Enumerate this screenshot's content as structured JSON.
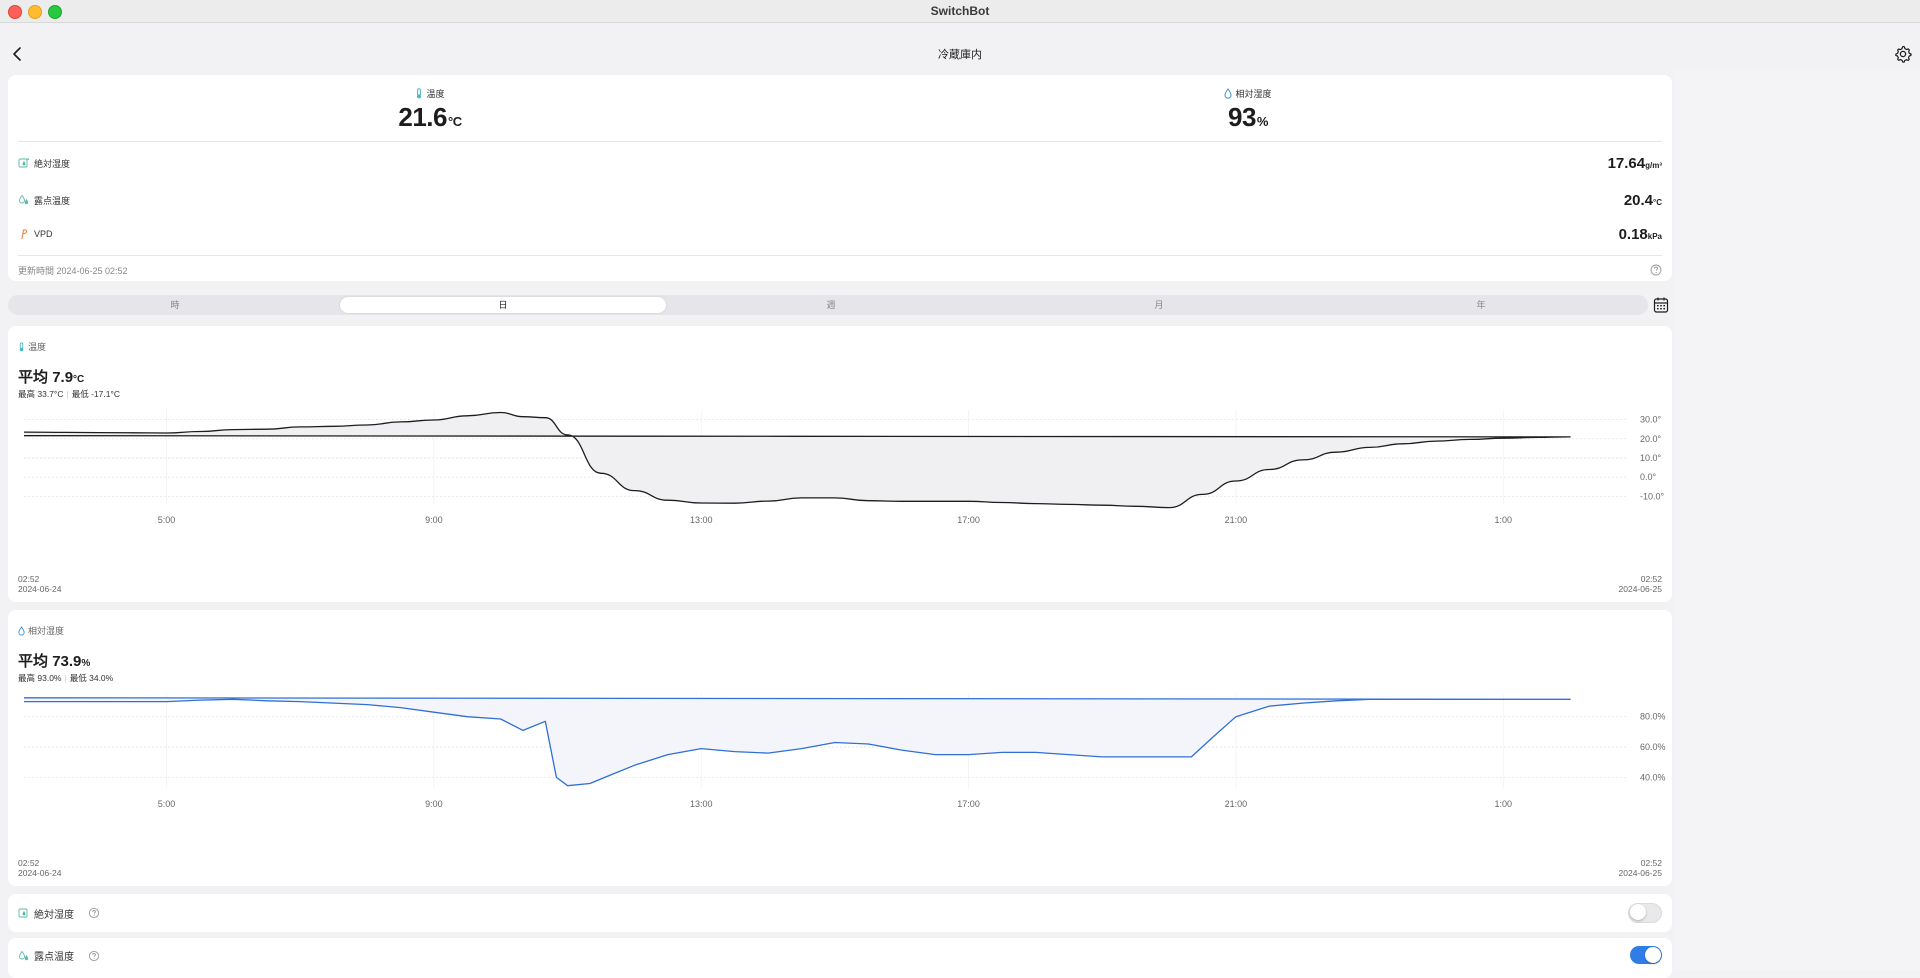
{
  "app": {
    "title": "SwitchBot"
  },
  "nav": {
    "title": "冷蔵庫内"
  },
  "summary": {
    "temperature": {
      "label": "温度",
      "value": "21.6",
      "unit": "°C"
    },
    "humidity": {
      "label": "相対湿度",
      "value": "93",
      "unit": "%"
    },
    "rows": [
      {
        "label": "絶対湿度",
        "value": "17.64",
        "unit": "g/m³",
        "icon": "absolute-humidity-icon"
      },
      {
        "label": "露点温度",
        "value": "20.4",
        "unit": "°C",
        "icon": "dew-point-icon"
      },
      {
        "label": "VPD",
        "value": "0.18",
        "unit": "kPa",
        "icon": "vpd-icon"
      }
    ],
    "updated": "更新時間 2024-06-25 02:52"
  },
  "range_tabs": {
    "items": [
      "時",
      "日",
      "週",
      "月",
      "年"
    ],
    "selected": "日"
  },
  "temp_chart": {
    "label": "温度",
    "avg_prefix": "平均",
    "avg_value": "7.9",
    "avg_unit": "°C",
    "max_label": "最高",
    "max_value": "33.7°C",
    "min_label": "最低",
    "min_value": "-17.1°C",
    "start_time": "02:52",
    "start_date": "2024-06-24",
    "end_time": "02:52",
    "end_date": "2024-06-25"
  },
  "hum_chart": {
    "label": "相対湿度",
    "avg_prefix": "平均",
    "avg_value": "73.9",
    "avg_unit": "%",
    "max_label": "最高",
    "max_value": "93.0%",
    "min_label": "最低",
    "min_value": "34.0%",
    "start_time": "02:52",
    "start_date": "2024-06-24",
    "end_time": "02:52",
    "end_date": "2024-06-25"
  },
  "toggles": {
    "absolute_humidity": {
      "label": "絶対湿度",
      "on": false
    },
    "dew_point": {
      "label": "露点温度",
      "on": true
    }
  },
  "chart_data": [
    {
      "type": "area",
      "x_ticks": [
        "5:00",
        "9:00",
        "13:00",
        "17:00",
        "21:00",
        "1:00"
      ],
      "y_ticks": [
        "30.0°",
        "20.0°",
        "10.0°",
        "0.0°",
        "-10.0°"
      ],
      "ylim": [
        -14,
        35
      ],
      "grid": true,
      "line_color": "#1d1d1f",
      "fill_color": "#f0f0f2",
      "series": [
        {
          "x": [
            "02:52",
            "03:30",
            "04:30",
            "05:00",
            "05:30",
            "06:00",
            "06:30",
            "07:00",
            "07:30",
            "08:00",
            "08:30",
            "09:00",
            "09:30",
            "10:00",
            "10:20",
            "10:40",
            "11:00",
            "11:30",
            "12:00",
            "12:30",
            "13:00",
            "13:30",
            "14:00",
            "14:30",
            "15:00",
            "15:30",
            "16:00",
            "16:30",
            "17:00",
            "17:30",
            "18:00",
            "18:30",
            "19:00",
            "19:30",
            "20:00",
            "20:30",
            "21:00",
            "21:30",
            "22:00",
            "22:30",
            "23:00",
            "23:30",
            "00:00",
            "00:30",
            "01:00",
            "01:30",
            "02:00",
            "02:52"
          ],
          "y": [
            23.5,
            23.3,
            23.1,
            23.0,
            23.8,
            24.8,
            25.0,
            26.2,
            26.5,
            27.2,
            28.8,
            29.8,
            32.0,
            33.7,
            31.5,
            31.0,
            22.0,
            2.0,
            -7.0,
            -12.0,
            -13.5,
            -13.6,
            -12.5,
            -10.8,
            -10.8,
            -12.3,
            -12.6,
            -12.6,
            -12.6,
            -13.2,
            -13.8,
            -14.2,
            -14.6,
            -15.2,
            -15.9,
            -9.0,
            -2.0,
            4.0,
            9.0,
            13.0,
            15.5,
            17.4,
            18.8,
            19.7,
            20.3,
            20.7,
            21.0,
            21.6
          ]
        }
      ]
    },
    {
      "type": "area",
      "x_ticks": [
        "5:00",
        "9:00",
        "13:00",
        "17:00",
        "21:00",
        "1:00"
      ],
      "y_ticks": [
        "80.0%",
        "60.0%",
        "40.0%"
      ],
      "ylim": [
        33,
        95
      ],
      "grid": true,
      "line_color": "#2f6fd6",
      "fill_color": "#f4f5fb",
      "series": [
        {
          "x": [
            "02:52",
            "04:30",
            "05:00",
            "05:30",
            "06:00",
            "06:30",
            "07:00",
            "07:30",
            "08:00",
            "08:30",
            "09:00",
            "09:30",
            "10:00",
            "10:20",
            "10:40",
            "10:50",
            "11:00",
            "11:20",
            "11:40",
            "12:00",
            "12:30",
            "13:00",
            "13:30",
            "14:00",
            "14:30",
            "15:00",
            "15:30",
            "16:00",
            "16:30",
            "17:00",
            "17:30",
            "18:00",
            "18:30",
            "19:00",
            "19:30",
            "20:00",
            "20:20",
            "20:40",
            "21:00",
            "21:30",
            "22:00",
            "22:30",
            "23:00",
            "23:30",
            "00:00",
            "00:30",
            "01:00",
            "01:30",
            "02:00",
            "02:52"
          ],
          "y": [
            90.0,
            90.0,
            90.0,
            91.0,
            91.5,
            90.5,
            90.0,
            89.0,
            88.0,
            86.0,
            83.0,
            80.0,
            78.5,
            71.0,
            77.0,
            40.0,
            34.5,
            36.0,
            42.0,
            48.0,
            55.0,
            59.0,
            57.0,
            56.0,
            59.0,
            63.0,
            62.0,
            58.0,
            55.0,
            55.0,
            56.5,
            56.5,
            55.0,
            53.5,
            53.5,
            53.5,
            53.5,
            67.0,
            80.0,
            87.0,
            89.0,
            90.5,
            91.5,
            91.5,
            91.5,
            91.5,
            91.5,
            91.5,
            91.5,
            92.5
          ]
        }
      ]
    }
  ]
}
